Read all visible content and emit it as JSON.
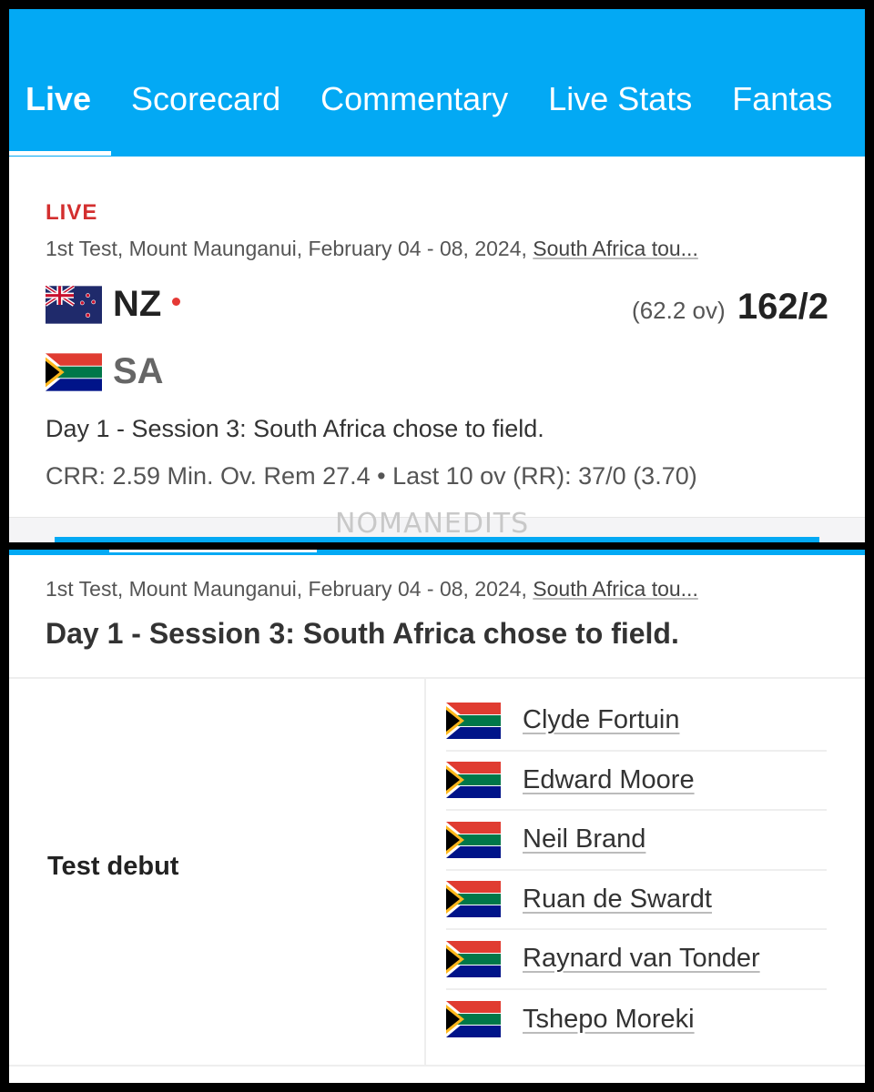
{
  "tabs": [
    {
      "label": "Live",
      "active": true
    },
    {
      "label": "Scorecard"
    },
    {
      "label": "Commentary"
    },
    {
      "label": "Live Stats"
    },
    {
      "label": "Fantas"
    }
  ],
  "match": {
    "status": "LIVE",
    "meta": "1st Test, Mount Maunganui, February 04 - 08, 2024,",
    "series_link": "South Africa tou...",
    "team1": {
      "abbr": "NZ",
      "flag": "new-zealand-flag",
      "batting": true,
      "overs": "(62.2 ov)",
      "score": "162/2"
    },
    "team2": {
      "abbr": "SA",
      "flag": "south-africa-flag"
    },
    "status_text": "Day 1 - Session 3: South Africa chose to field.",
    "rates": "CRR: 2.59  Min. Ov. Rem 27.4 • Last 10 ov (RR): 37/0 (3.70)"
  },
  "watermark": "NOMANEDITS",
  "details": {
    "meta": "1st Test, Mount Maunganui, February 04 - 08, 2024,",
    "series_link": "South Africa tou...",
    "title": "Day 1 - Session 3: South Africa chose to field.",
    "debut_label": "Test debut",
    "players": [
      "Clyde Fortuin",
      "Edward Moore",
      "Neil Brand",
      "Ruan de Swardt",
      "Raynard van Tonder",
      "Tshepo Moreki"
    ]
  },
  "colors": {
    "accent": "#03a9f4",
    "live": "#d32f2f"
  }
}
